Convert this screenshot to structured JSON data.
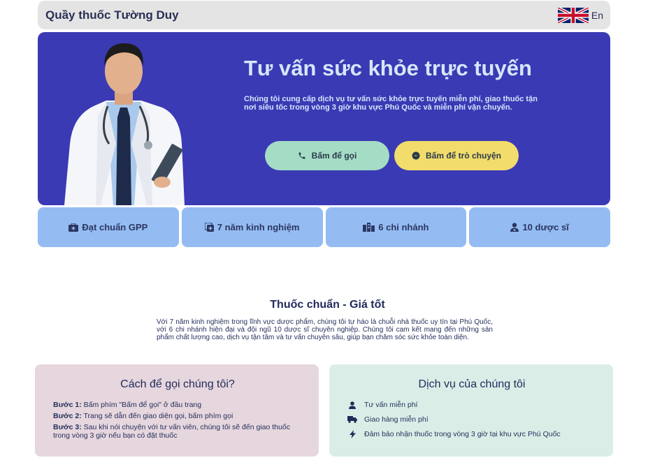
{
  "header": {
    "brand": "Quầy thuốc Tường Duy",
    "language_label": "En"
  },
  "hero": {
    "title": "Tư vấn sức khỏe trực tuyến",
    "description": "Chúng tôi cung cấp dịch vụ tư vấn sức khỏe trực tuyến miễn phí, giao thuốc tận nơi siêu tốc trong vòng 3 giờ khu vực Phú Quốc và miễn phí vận chuyển.",
    "call_button": "Bấm để gọi",
    "chat_button": "Bấm để trò chuyện"
  },
  "stats": [
    {
      "label": "Đạt chuẩn GPP",
      "icon": "medkit-icon"
    },
    {
      "label": "7 năm kinh nghiệm",
      "icon": "plus-copy-icon"
    },
    {
      "label": "6 chi nhánh",
      "icon": "building-icon"
    },
    {
      "label": "10 dược sĩ",
      "icon": "pharmacist-icon"
    }
  ],
  "about": {
    "title": "Thuốc chuẩn - Giá tốt",
    "text": "Với 7 năm kinh nghiệm trong lĩnh vực dược phẩm, chúng tôi tự hào là chuỗi nhà thuốc uy tín tại Phú Quốc, với 6 chi nhánh hiện đại và đội ngũ 10 dược sĩ chuyên nghiệp. Chúng tôi cam kết mang đến những sản phẩm chất lượng cao, dịch vụ tận tâm và tư vấn chuyên sâu, giúp bạn chăm sóc sức khỏe toàn diện."
  },
  "how_to_call": {
    "title": "Cách để gọi chúng tôi?",
    "steps": [
      {
        "label": "Bước 1:",
        "text": "Bấm phím \"Bấm để gọi\" ở đầu trang"
      },
      {
        "label": "Bước 2:",
        "text": "Trang sẽ dẫn đến giao diện gọi, bấm phím gọi"
      },
      {
        "label": "Bước 3:",
        "text": "Sau khi nói chuyện với tư vấn viên, chúng tôi sẽ đến giao thuốc trong vòng 3 giờ nếu bạn có đặt thuốc"
      }
    ]
  },
  "services": {
    "title": "Dịch vụ của chúng tôi",
    "items": [
      {
        "text": "Tư vấn miễn phí",
        "icon": "user-icon"
      },
      {
        "text": "Giao hàng miễn phí",
        "icon": "truck-icon"
      },
      {
        "text": "Đảm bảo nhận thuốc trong vòng 3 giờ tại khu vực Phú Quốc",
        "icon": "bolt-icon"
      }
    ]
  },
  "colors": {
    "hero_bg": "#3a3ab4",
    "stat_bg": "#94bcf3",
    "call_button": "#a5dcc6",
    "chat_button": "#f2dc6b",
    "call_card": "#e6d6dd",
    "service_card": "#daeee7"
  }
}
